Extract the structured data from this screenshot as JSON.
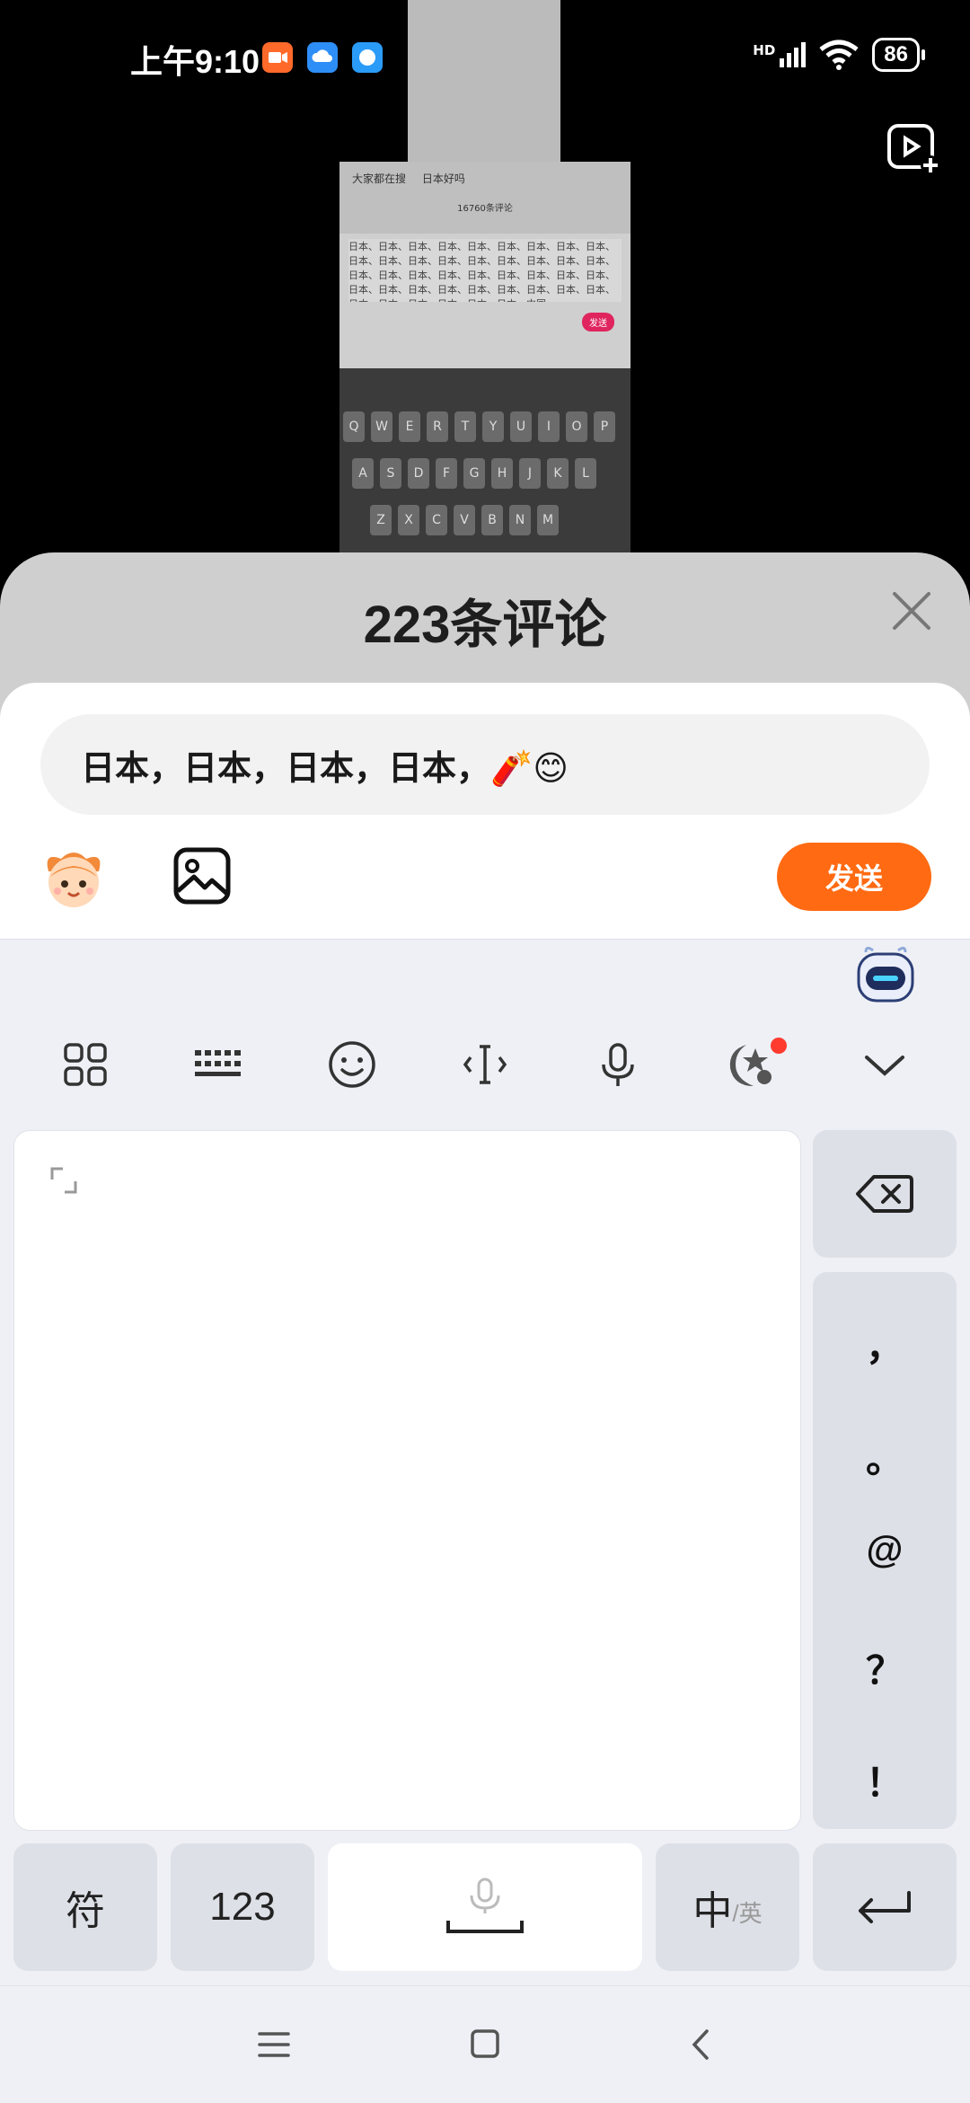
{
  "status_bar": {
    "time": "上午9:10",
    "signal_label": "HD",
    "battery": "86",
    "icons": [
      "camera-app-icon",
      "cloud-app-icon",
      "message-app-icon",
      "hd-signal-icon",
      "wifi-icon",
      "battery-icon"
    ]
  },
  "background_window": {
    "header_left": "大家都在搜",
    "header_right": "日本好吗",
    "comment_count": "16760条评论",
    "text_preview": "日本、日本、日本、日本、日本、日本、日本、日本、日本、日本、日本、日本、日本、日本、日本、日本、日本、日本、日本、日本、日本、日本、日本、日本、日本、日本、日本、日本、日本、日本、日本、日本、日本、日本、日本、日本、日本、日本、日本、日本、日本、日本、中国",
    "send_label": "发送",
    "keys_row1": [
      "Q",
      "W",
      "E",
      "R",
      "T",
      "Y",
      "U",
      "I",
      "O",
      "P"
    ],
    "keys_row2": [
      "A",
      "S",
      "D",
      "F",
      "G",
      "H",
      "J",
      "K",
      "L"
    ],
    "keys_row3": [
      "Z",
      "X",
      "C",
      "V",
      "B",
      "N",
      "M"
    ]
  },
  "comments": {
    "title": "223条评论",
    "input_value": "日本，日本，日本，日本，🧨😊",
    "send_label": "发送"
  },
  "keyboard": {
    "toolbar": [
      "apps-icon",
      "keyboard-layout-icon",
      "emoji-icon",
      "cursor-icon",
      "microphone-icon",
      "magic-star-icon",
      "collapse-chevron-icon"
    ],
    "punctuation": [
      "，",
      "。",
      "@",
      "？",
      "！"
    ],
    "symbol_key": "符",
    "number_key": "123",
    "lang_key_main": "中",
    "lang_key_sub": "/英"
  },
  "colors": {
    "accent_orange": "#ff6a12",
    "badge_red": "#ff3b30",
    "keyboard_bg": "#eef0f5",
    "key_bg": "#dde0e7"
  }
}
